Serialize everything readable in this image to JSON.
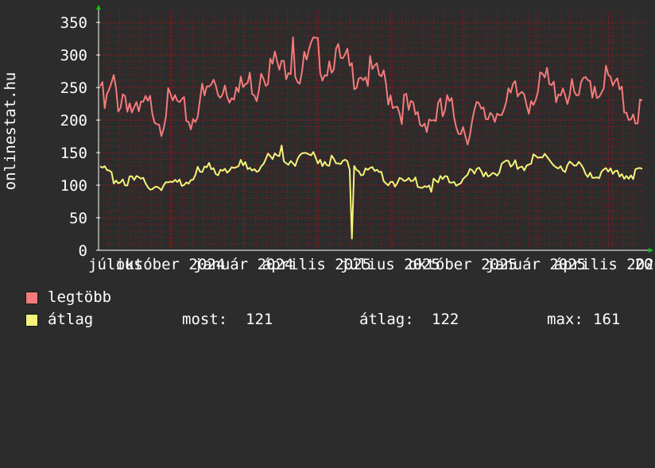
{
  "chart_data": {
    "type": "line",
    "ylabel": "onlinestat.hu",
    "ylim": [
      0,
      360
    ],
    "yticks": [
      0,
      50,
      100,
      150,
      200,
      250,
      300,
      350
    ],
    "x_tick_labels": [
      "július",
      "október 2024",
      "január 2024",
      "április 2025",
      "július 2025",
      "október 2025",
      "január 2025",
      "április 2026",
      "20"
    ],
    "x_tick_positions": [
      0,
      0.132,
      0.266,
      0.4,
      0.535,
      0.668,
      0.802,
      0.935,
      1.0
    ],
    "colors": {
      "legtobb": "#f47b7b",
      "atlag": "#f4f47b",
      "grid": "#8b1a1a",
      "axis": "#ffffff",
      "arrow": "#00cc00"
    },
    "series": [
      {
        "name": "legtöbb",
        "values": [
          252,
          215,
          240,
          255,
          225,
          245,
          230,
          210,
          200,
          220,
          215,
          225,
          210,
          200,
          225,
          220,
          230,
          205,
          215,
          195,
          210,
          240,
          230,
          250,
          255,
          240,
          260,
          245,
          255,
          240,
          250,
          255,
          260,
          245,
          290,
          275,
          280,
          290,
          270,
          285,
          295,
          280,
          270,
          285,
          295,
          310,
          300,
          280,
          290,
          300,
          295,
          280,
          285,
          270,
          275,
          280,
          265,
          275,
          260,
          270,
          250,
          240,
          235,
          215,
          225,
          210,
          205,
          200,
          195,
          210,
          200,
          215,
          205,
          220,
          210,
          200,
          195,
          185,
          190,
          210,
          205,
          200,
          215,
          210,
          230,
          215,
          225,
          240,
          235,
          250,
          230,
          245,
          240,
          255,
          260,
          240,
          250,
          255,
          245,
          240,
          230,
          235,
          250,
          260,
          255,
          245,
          270,
          255,
          250,
          240,
          225,
          215,
          220,
          210,
          220
        ],
        "min": 150,
        "max": 327
      },
      {
        "name": "átlag",
        "values": [
          122,
          118,
          115,
          110,
          112,
          108,
          104,
          105,
          102,
          100,
          104,
          101,
          99,
          102,
          100,
          105,
          110,
          115,
          120,
          118,
          124,
          122,
          126,
          130,
          128,
          125,
          130,
          128,
          132,
          131,
          135,
          138,
          140,
          136,
          142,
          139,
          140,
          145,
          148,
          145,
          142,
          140,
          138,
          135,
          132,
          130,
          128,
          130,
          122,
          115,
          118,
          116,
          112,
          108,
          105,
          110,
          105,
          102,
          108,
          104,
          100,
          100,
          102,
          104,
          106,
          110,
          108,
          112,
          115,
          114,
          118,
          120,
          122,
          125,
          124,
          128,
          126,
          130,
          132,
          135,
          138,
          140,
          142,
          138,
          135,
          132,
          130,
          128,
          126,
          124,
          120,
          122,
          118,
          116,
          115,
          118,
          120,
          119,
          118,
          117,
          121
        ],
        "min": 18,
        "max": 161
      }
    ],
    "legend": [
      {
        "key": "legtobb",
        "label": "legtöbb"
      },
      {
        "key": "atlag",
        "label": "átlag",
        "most_label": "most:",
        "most": "121",
        "atlag_label": "átlag:",
        "atlag_value": "122",
        "max_label": "max:",
        "max": "161"
      }
    ]
  }
}
